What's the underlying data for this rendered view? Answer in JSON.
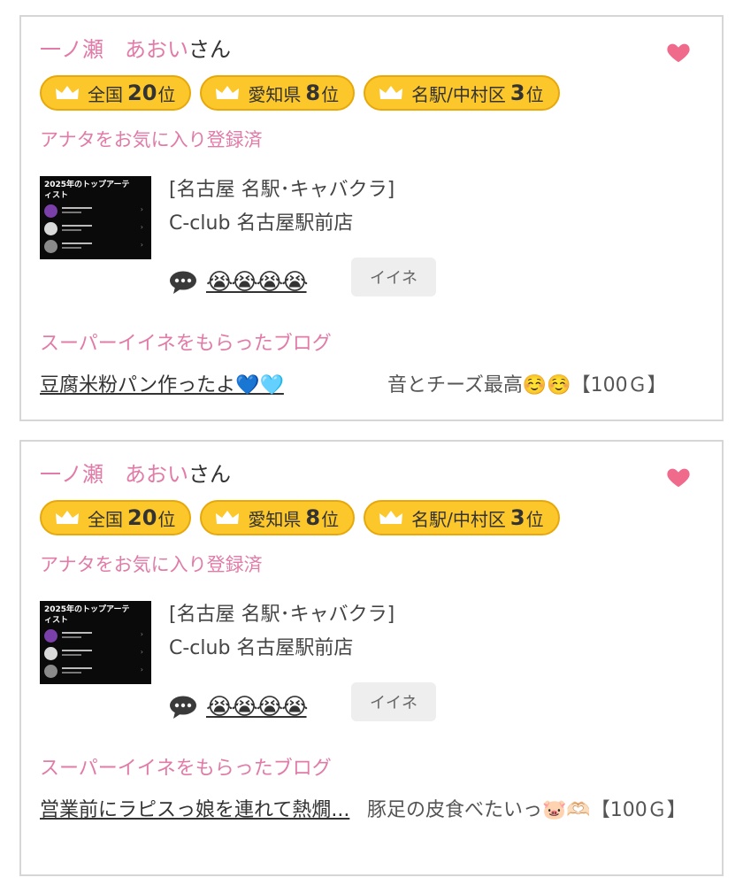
{
  "cards": [
    {
      "girl_name": "一ノ瀬　あおい",
      "honorific": "さん",
      "rankings": [
        {
          "prefix": "全国",
          "rank": "20",
          "suffix": "位"
        },
        {
          "prefix": "愛知県",
          "rank": "8",
          "suffix": "位"
        },
        {
          "prefix": "名駅/中村区",
          "rank": "3",
          "suffix": "位"
        }
      ],
      "favorite_status": "アナタをお気に入り登録済",
      "thumbnail_title": "2025年のトップアーティスト",
      "shop_area": "[名古屋 名駅･キャバクラ]",
      "shop_name": "C-club 名古屋駅前店",
      "reactions": "😭😭😭😭",
      "like_label": "イイネ",
      "super_like_label": "スーパーイイネをもらったブログ",
      "blog_title": "豆腐米粉パン作ったよ💙🩵",
      "blog_comment": "音とチーズ最高☺️☺️【100Ｇ】"
    },
    {
      "girl_name": "一ノ瀬　あおい",
      "honorific": "さん",
      "rankings": [
        {
          "prefix": "全国",
          "rank": "20",
          "suffix": "位"
        },
        {
          "prefix": "愛知県",
          "rank": "8",
          "suffix": "位"
        },
        {
          "prefix": "名駅/中村区",
          "rank": "3",
          "suffix": "位"
        }
      ],
      "favorite_status": "アナタをお気に入り登録済",
      "thumbnail_title": "2025年のトップアーティスト",
      "shop_area": "[名古屋 名駅･キャバクラ]",
      "shop_name": "C-club 名古屋駅前店",
      "reactions": "😭😭😭😭",
      "like_label": "イイネ",
      "super_like_label": "スーパーイイネをもらったブログ",
      "blog_title": "営業前にラピスっ娘を連れて熱燗...",
      "blog_comment": "豚足の皮食べたいっ🐷🫶🏻【100Ｇ】"
    }
  ],
  "colors": {
    "accent_pink": "#e17ba8",
    "heart": "#f06a8c",
    "badge_fill": "#fcc72a",
    "badge_border": "#e6a80a"
  },
  "icons": {
    "favorite": "heart-icon",
    "rank": "crown-icon",
    "comment": "speech-bubble-icon"
  }
}
